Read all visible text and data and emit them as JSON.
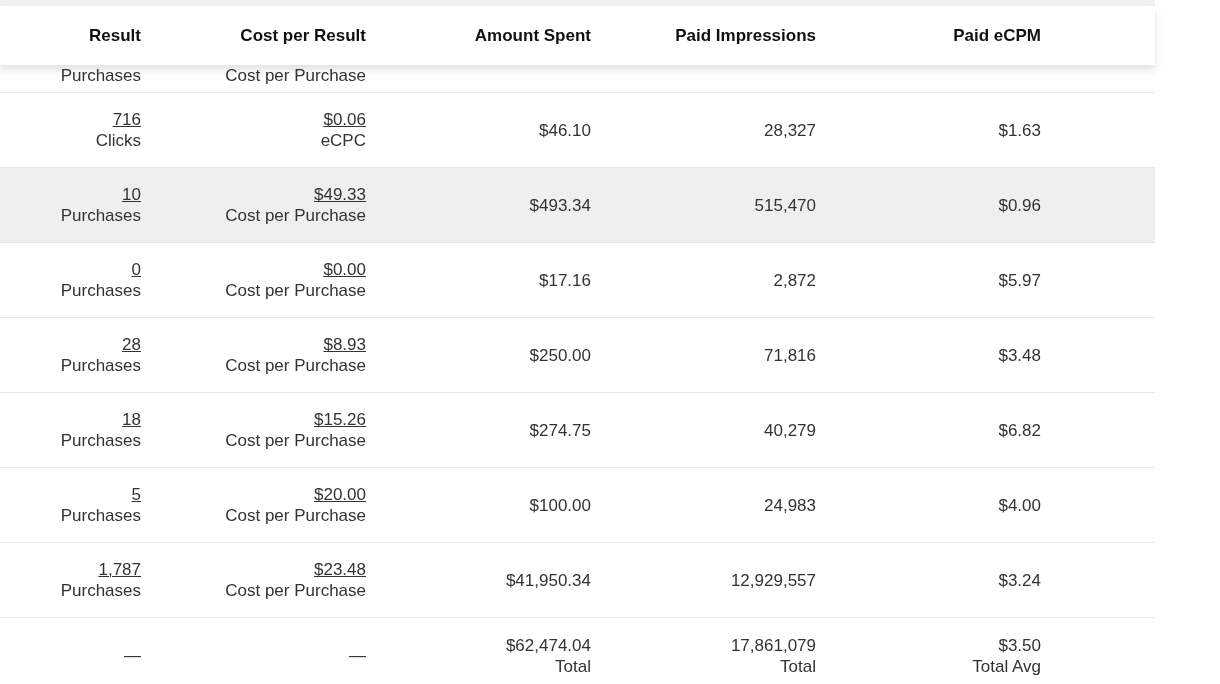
{
  "columns": [
    "Result",
    "Cost per Result",
    "Amount Spent",
    "Paid Impressions",
    "Paid eCPM"
  ],
  "partial_row": {
    "result_label": "Purchases",
    "cost_label": "Cost per Purchase"
  },
  "rows": [
    {
      "result": "716",
      "result_label": "Clicks",
      "cost": "$0.06",
      "cost_label": "eCPC",
      "amount": "$46.10",
      "impressions": "28,327",
      "ecpm": "$1.63",
      "highlighted": false
    },
    {
      "result": "10",
      "result_label": "Purchases",
      "cost": "$49.33",
      "cost_label": "Cost per Purchase",
      "amount": "$493.34",
      "impressions": "515,470",
      "ecpm": "$0.96",
      "highlighted": true
    },
    {
      "result": "0",
      "result_label": "Purchases",
      "cost": "$0.00",
      "cost_label": "Cost per Purchase",
      "amount": "$17.16",
      "impressions": "2,872",
      "ecpm": "$5.97",
      "highlighted": false
    },
    {
      "result": "28",
      "result_label": "Purchases",
      "cost": "$8.93",
      "cost_label": "Cost per Purchase",
      "amount": "$250.00",
      "impressions": "71,816",
      "ecpm": "$3.48",
      "highlighted": false
    },
    {
      "result": "18",
      "result_label": "Purchases",
      "cost": "$15.26",
      "cost_label": "Cost per Purchase",
      "amount": "$274.75",
      "impressions": "40,279",
      "ecpm": "$6.82",
      "highlighted": false
    },
    {
      "result": "5",
      "result_label": "Purchases",
      "cost": "$20.00",
      "cost_label": "Cost per Purchase",
      "amount": "$100.00",
      "impressions": "24,983",
      "ecpm": "$4.00",
      "highlighted": false
    },
    {
      "result": "1,787",
      "result_label": "Purchases",
      "cost": "$23.48",
      "cost_label": "Cost per Purchase",
      "amount": "$41,950.34",
      "impressions": "12,929,557",
      "ecpm": "$3.24",
      "highlighted": false
    }
  ],
  "totals": {
    "result": "—",
    "cost": "—",
    "amount": "$62,474.04",
    "amount_label": "Total",
    "impressions": "17,861,079",
    "impressions_label": "Total",
    "ecpm": "$3.50",
    "ecpm_label": "Total Avg"
  }
}
